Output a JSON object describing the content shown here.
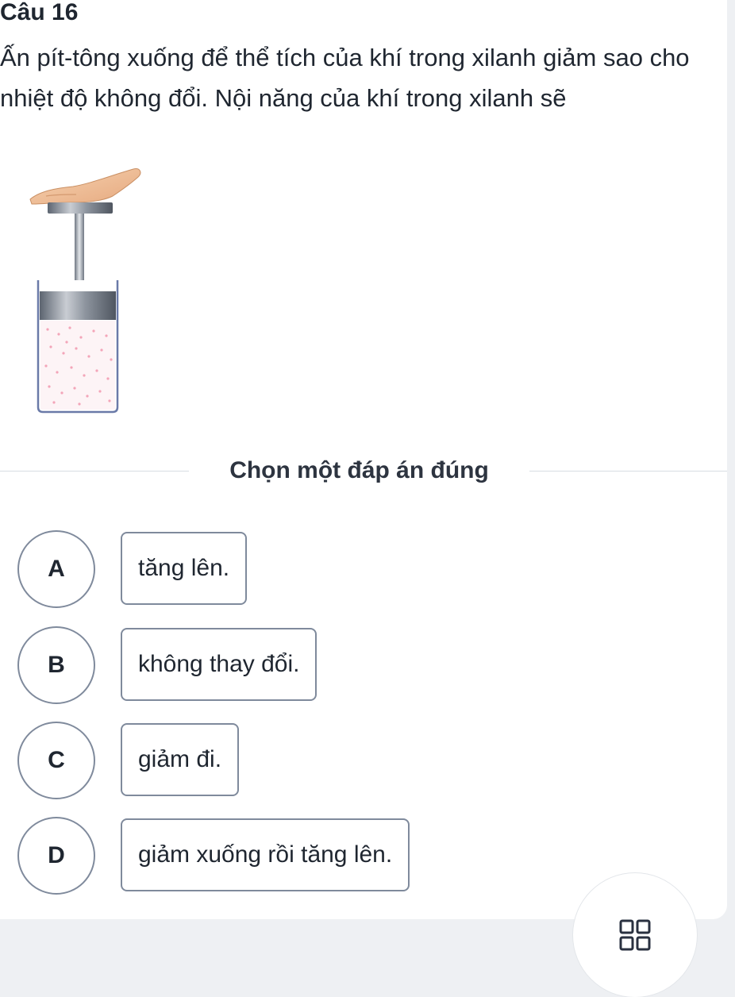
{
  "question": {
    "title": "Câu 16",
    "text": "Ấn pít-tông xuống để thể tích của khí trong xilanh giảm sao cho nhiệt độ không đổi. Nội năng của khí trong xilanh sẽ",
    "figure_icon": "piston-cylinder-with-hand"
  },
  "answers": {
    "instruction": "Chọn một đáp án đúng",
    "options": [
      {
        "letter": "A",
        "text": "tăng lên."
      },
      {
        "letter": "B",
        "text": "không thay đổi."
      },
      {
        "letter": "C",
        "text": "giảm đi."
      },
      {
        "letter": "D",
        "text": "giảm xuống rồi tăng lên."
      }
    ]
  },
  "toolbar": {
    "grid_icon": "grid-four-squares-icon"
  },
  "colors": {
    "border": "#7f8a9c",
    "background": "#eef0f3",
    "card": "#ffffff",
    "text": "#1f2630"
  }
}
